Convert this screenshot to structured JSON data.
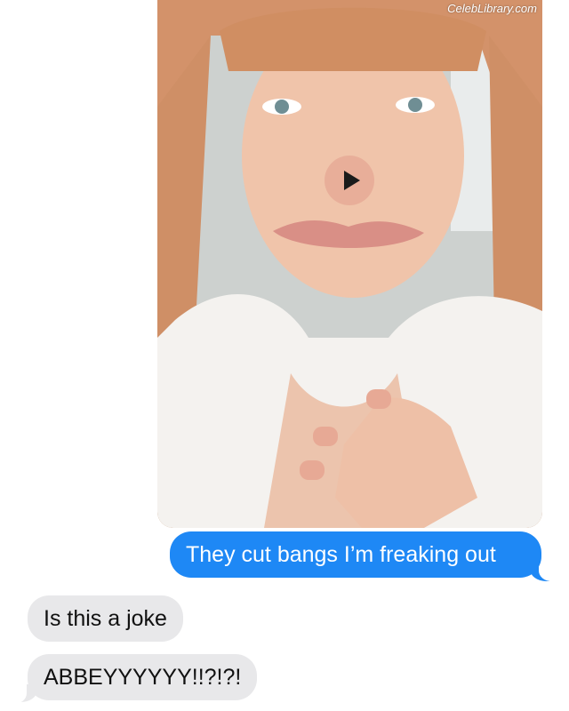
{
  "watermark": "CelebLibrary.com",
  "video_message": {
    "play_icon": "play-icon",
    "subject": "selfie video of a red-haired woman in a white robe"
  },
  "messages": [
    {
      "direction": "sent",
      "text": "They cut bangs I’m freaking out"
    },
    {
      "direction": "received",
      "text": "Is this a joke"
    },
    {
      "direction": "received",
      "text": "ABBEYYYYYY!!?!?!"
    }
  ],
  "colors": {
    "sent_bubble": "#1e88f5",
    "received_bubble": "#e8e8ea",
    "sent_text": "#ffffff",
    "received_text": "#111111"
  }
}
